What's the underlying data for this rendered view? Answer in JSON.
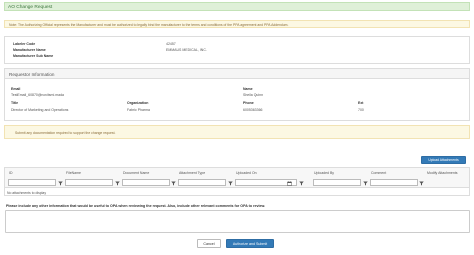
{
  "header": {
    "title": "AO Change Request"
  },
  "notice": {
    "text": "Note: The Authorizing Official represents the Manufacturer and must be authorized to legally bind the manufacturer to the terms and conditions of the PPA agreement and PPA Addendum."
  },
  "manufacturer": {
    "labeler_code_label": "Labeler Code",
    "labeler_code_value": "42457",
    "name_label": "Manufacturer Name",
    "name_value": "EMMAUS MEDICAL, INC.",
    "sub_name_label": "Manufacturer Sub Name",
    "sub_name_value": ""
  },
  "requestor": {
    "section_title": "Requestor Information",
    "email_label": "Email",
    "email_value": "TestEmail_60870@novitsmi.mada",
    "name_label": "Name",
    "name_value": "Sheila Quinn",
    "title_label": "Title",
    "title_value": "Director of Marketing and Operations",
    "organization_label": "Organization",
    "organization_value": "Fabric Pharma",
    "phone_label": "Phone",
    "phone_value": "6005363366",
    "ext_label": "Ext",
    "ext_value": "700"
  },
  "doc_note": {
    "text": "Submit any documentation required to support the change request."
  },
  "attachments": {
    "upload_button": "Upload Attachments",
    "columns": [
      "ID",
      "FileName",
      "Document Name",
      "Attachment Type",
      "Uploaded On",
      "Uploaded By",
      "Comment",
      "Modify Attachments"
    ],
    "empty_text": "No attachments to display"
  },
  "other_info": {
    "label": "Please include any other information that would be useful to OPA when reviewing the request. Also, include other relevant comments for OPA to review.",
    "value": ""
  },
  "actions": {
    "cancel": "Cancel",
    "submit": "Authorize and Submit"
  },
  "colors": {
    "primary": "#337ab7",
    "success_bg": "#dff0d8",
    "warning_bg": "#fcf8e3"
  },
  "icons": {
    "filter": "funnel-icon",
    "calendar": "calendar-icon"
  }
}
